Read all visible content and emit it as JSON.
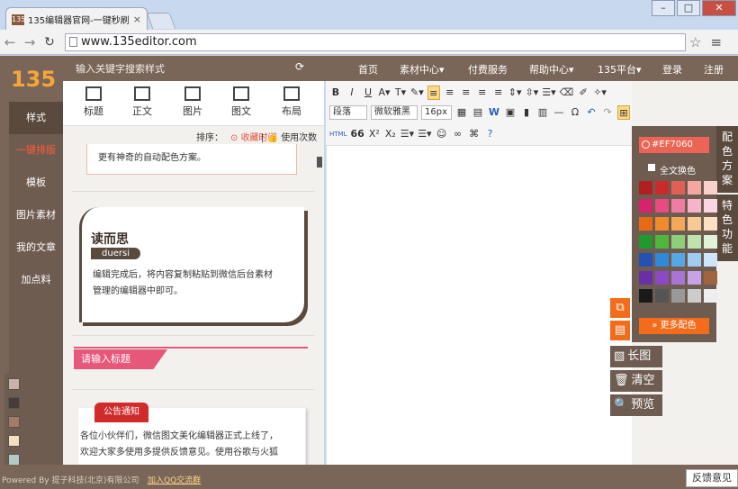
{
  "browser": {
    "tab_title": "135编辑器官网-一键秒刷",
    "tab_favicon": "135",
    "url": "www.135editor.com",
    "window_controls": [
      "–",
      "□",
      "✕"
    ]
  },
  "header": {
    "logo": "135",
    "search_hint": "输入关键字搜索样式",
    "nav": [
      "首页",
      "素材中心▾",
      "付费服务",
      "帮助中心▾",
      "135平台▾",
      "登录",
      "注册"
    ]
  },
  "sidebar": {
    "items": [
      "样式",
      "一键排版",
      "模板",
      "图片素材",
      "我的文章",
      "加点料"
    ],
    "swatches": [
      "#c9b3a6",
      "#4a3b3b",
      "#a47a66",
      "#f4dfc0",
      "#b7c9c4"
    ]
  },
  "tools": [
    "标题",
    "正文",
    "图片",
    "图文",
    "布局"
  ],
  "sortbar": {
    "label": "排序：",
    "by_time": "收藏时间",
    "by_usage": "使用次数"
  },
  "styles": {
    "card1_text": "更有神奇的自动配色方案。",
    "card2_title": "读而思",
    "card2_tag": "duersi",
    "card2_line1": "编辑完成后，将内容复制粘贴到微信后台素材",
    "card2_line2": "管理的编辑器中即可。",
    "card3_title": "请输入标题",
    "card4_badge": "公告通知",
    "card4_line1": "各位小伙伴们，微信图文美化编辑器正式上线了，",
    "card4_line2": "欢迎大家多使用多提供反馈意见。使用谷歌与火狐"
  },
  "editor": {
    "row1": [
      "B",
      "I",
      "U",
      "A▾",
      "T▾",
      "✎▾"
    ],
    "align": [
      "≡",
      "≡",
      "≡",
      "≡",
      "≡"
    ],
    "row2_dropdowns": [
      "段落",
      "微软雅黑",
      "16px"
    ],
    "row3": [
      "HTML",
      "66",
      "X²",
      "X₂",
      "☰▾",
      "☰▾",
      "☺",
      "∞",
      "⌘",
      "?"
    ]
  },
  "colorpanel": {
    "hex": "#EF7060",
    "full_change": "全文换色",
    "more": "更多配色",
    "swatches": [
      [
        "#b02020",
        "#cc2a2a",
        "#e06055",
        "#f4a6a0",
        "#f8d0cc"
      ],
      [
        "#d6236a",
        "#e84a82",
        "#f07ba3",
        "#f6b4cb",
        "#fad6e3"
      ],
      [
        "#e86a12",
        "#f08a2c",
        "#f4a85a",
        "#f8c994",
        "#fbe0c4"
      ],
      [
        "#1e9a2e",
        "#4fb83a",
        "#8cd07a",
        "#bde3ae",
        "#e0f2d8"
      ],
      [
        "#2452b2",
        "#2f88d8",
        "#55a8e8",
        "#9dcdf2",
        "#cfe6f8"
      ],
      [
        "#6a2ea8",
        "#8a4ac4",
        "#a874d6",
        "#c6a2e6",
        "#a0643e"
      ],
      [
        "#1a1a1a",
        "#555555",
        "#999999",
        "#cccccc",
        "#eeeeee"
      ]
    ]
  },
  "right_tabs": [
    "配色方案",
    "特色功能"
  ],
  "actions": {
    "long_image": "长图",
    "clear": "清空",
    "preview": "预览"
  },
  "footer": {
    "copyright": "Powered By 提子科技(北京)有限公司",
    "qq": "加入QQ交流群",
    "feedback": "反馈意见"
  }
}
